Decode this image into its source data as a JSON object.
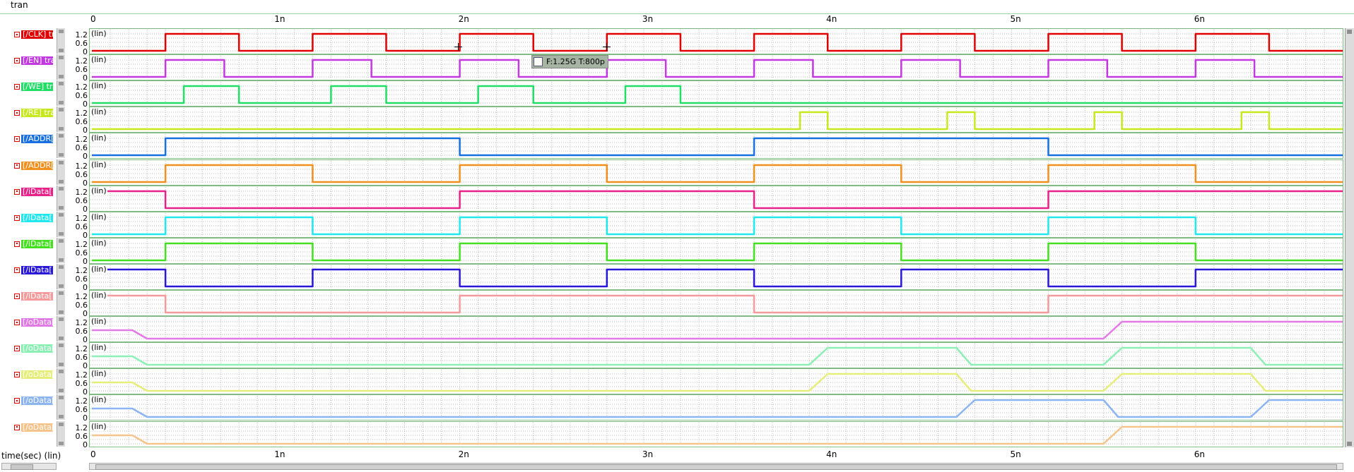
{
  "window": {
    "title": "tran"
  },
  "x_axis": {
    "label": "time(sec) (lin)",
    "tick_labels": [
      "0",
      "1n",
      "2n",
      "3n",
      "4n",
      "5n",
      "6n"
    ]
  },
  "y_axis": {
    "scale_label": "(lin)",
    "tick_labels": [
      "1.2",
      "0.6",
      "0"
    ]
  },
  "cursor": {
    "readout": "F:1.25G T:800p"
  },
  "chart_data": {
    "type": "line",
    "title": "tran",
    "xlabel": "time(sec) (lin)",
    "ylabel": "",
    "x_unit": "s",
    "xlim": [
      0,
      6.8e-09
    ],
    "ylim": [
      0,
      1.2
    ],
    "grid": true,
    "series": [
      {
        "name": "[/CLK] tr",
        "color": "#e00000",
        "levels": [
          [
            0,
            0
          ],
          [
            4e-10,
            1.2
          ],
          [
            8e-10,
            0
          ],
          [
            1.2e-09,
            1.2
          ],
          [
            1.6e-09,
            0
          ],
          [
            2e-09,
            1.2
          ],
          [
            2.4e-09,
            0
          ],
          [
            2.8e-09,
            1.2
          ],
          [
            3.2e-09,
            0
          ],
          [
            3.6e-09,
            1.2
          ],
          [
            4e-09,
            0
          ],
          [
            4.4e-09,
            1.2
          ],
          [
            4.8e-09,
            0
          ],
          [
            5.2e-09,
            1.2
          ],
          [
            5.6e-09,
            0
          ],
          [
            6e-09,
            1.2
          ],
          [
            6.4e-09,
            0
          ],
          [
            6.8e-09,
            0
          ]
        ]
      },
      {
        "name": "[/EN] tra",
        "color": "#c23adf",
        "levels": [
          [
            0,
            0
          ],
          [
            4e-10,
            1.2
          ],
          [
            7.2e-10,
            0
          ],
          [
            1.2e-09,
            1.2
          ],
          [
            1.52e-09,
            0
          ],
          [
            2e-09,
            1.2
          ],
          [
            2.32e-09,
            0
          ],
          [
            2.8e-09,
            1.2
          ],
          [
            3.12e-09,
            0
          ],
          [
            3.6e-09,
            1.2
          ],
          [
            3.92e-09,
            0
          ],
          [
            4.4e-09,
            1.2
          ],
          [
            4.72e-09,
            0
          ],
          [
            5.2e-09,
            1.2
          ],
          [
            5.52e-09,
            0
          ],
          [
            6e-09,
            1.2
          ],
          [
            6.32e-09,
            0
          ],
          [
            6.8e-09,
            0
          ]
        ]
      },
      {
        "name": "[/WE] tra",
        "color": "#22dd66",
        "levels": [
          [
            0,
            0
          ],
          [
            5e-10,
            1.2
          ],
          [
            8e-10,
            0
          ],
          [
            1.3e-09,
            1.2
          ],
          [
            1.6e-09,
            0
          ],
          [
            2.1e-09,
            1.2
          ],
          [
            2.4e-09,
            0
          ],
          [
            2.9e-09,
            1.2
          ],
          [
            3.2e-09,
            0
          ],
          [
            6.8e-09,
            0
          ]
        ]
      },
      {
        "name": "[/RE] tra",
        "color": "#c8e81e",
        "levels": [
          [
            0,
            0
          ],
          [
            3.85e-09,
            1.2
          ],
          [
            4e-09,
            0
          ],
          [
            4.65e-09,
            1.2
          ],
          [
            4.8e-09,
            0
          ],
          [
            5.45e-09,
            1.2
          ],
          [
            5.6e-09,
            0
          ],
          [
            6.25e-09,
            1.2
          ],
          [
            6.4e-09,
            0
          ],
          [
            6.8e-09,
            0
          ]
        ]
      },
      {
        "name": "[/ADDR[",
        "color": "#1870e0",
        "levels": [
          [
            0,
            0
          ],
          [
            4e-10,
            1.2
          ],
          [
            2e-09,
            0
          ],
          [
            3.6e-09,
            1.2
          ],
          [
            5.2e-09,
            0
          ],
          [
            6.8e-09,
            0
          ]
        ]
      },
      {
        "name": "[/ADDR[",
        "color": "#f0901e",
        "levels": [
          [
            0,
            0
          ],
          [
            4e-10,
            1.2
          ],
          [
            1.2e-09,
            0
          ],
          [
            2e-09,
            1.2
          ],
          [
            2.8e-09,
            0
          ],
          [
            3.6e-09,
            1.2
          ],
          [
            4.4e-09,
            0
          ],
          [
            5.2e-09,
            1.2
          ],
          [
            6e-09,
            0
          ],
          [
            6.8e-09,
            0
          ]
        ]
      },
      {
        "name": "[/iData[",
        "color": "#e8208a",
        "levels": [
          [
            0,
            1.2
          ],
          [
            4e-10,
            0
          ],
          [
            2e-09,
            1.2
          ],
          [
            3.6e-09,
            0
          ],
          [
            5.2e-09,
            1.2
          ],
          [
            6.8e-09,
            1.2
          ]
        ]
      },
      {
        "name": "[/iData[",
        "color": "#20e8ee",
        "levels": [
          [
            0,
            0
          ],
          [
            4e-10,
            1.2
          ],
          [
            1.2e-09,
            0
          ],
          [
            2e-09,
            1.2
          ],
          [
            2.8e-09,
            0
          ],
          [
            3.6e-09,
            1.2
          ],
          [
            4.4e-09,
            0
          ],
          [
            5.2e-09,
            1.2
          ],
          [
            6e-09,
            0
          ],
          [
            6.8e-09,
            0
          ]
        ]
      },
      {
        "name": "[/iData[",
        "color": "#44e020",
        "levels": [
          [
            0,
            0
          ],
          [
            4e-10,
            1.2
          ],
          [
            1.2e-09,
            0
          ],
          [
            2e-09,
            1.2
          ],
          [
            2.8e-09,
            0
          ],
          [
            3.6e-09,
            1.2
          ],
          [
            4.4e-09,
            0
          ],
          [
            5.2e-09,
            1.2
          ],
          [
            6e-09,
            0
          ],
          [
            6.8e-09,
            0
          ]
        ]
      },
      {
        "name": "[/iData[",
        "color": "#2a18d8",
        "levels": [
          [
            0,
            1.2
          ],
          [
            4e-10,
            0
          ],
          [
            1.2e-09,
            1.2
          ],
          [
            2e-09,
            0
          ],
          [
            2.8e-09,
            1.2
          ],
          [
            3.6e-09,
            0
          ],
          [
            4.4e-09,
            1.2
          ],
          [
            5.2e-09,
            0
          ],
          [
            6e-09,
            1.2
          ],
          [
            6.8e-09,
            1.2
          ]
        ]
      },
      {
        "name": "[/iData[",
        "color": "#f49a9a",
        "levels": [
          [
            0,
            1.2
          ],
          [
            4e-10,
            0
          ],
          [
            2e-09,
            1.2
          ],
          [
            3.6e-09,
            0
          ],
          [
            5.2e-09,
            1.2
          ],
          [
            6.8e-09,
            1.2
          ]
        ]
      },
      {
        "name": "[/oData[",
        "color": "#e27ae6",
        "smooth": true,
        "levels": [
          [
            0,
            0.6
          ],
          [
            2.2e-10,
            0.6
          ],
          [
            3e-10,
            0
          ],
          [
            5.5e-09,
            0
          ],
          [
            5.6e-09,
            1.2
          ],
          [
            6.8e-09,
            1.2
          ]
        ]
      },
      {
        "name": "[/oData[",
        "color": "#8cf0b4",
        "smooth": true,
        "levels": [
          [
            0,
            0.6
          ],
          [
            2.2e-10,
            0.6
          ],
          [
            3e-10,
            0
          ],
          [
            3.9e-09,
            0
          ],
          [
            4e-09,
            1.2
          ],
          [
            4.7e-09,
            1.2
          ],
          [
            4.78e-09,
            0
          ],
          [
            5.5e-09,
            0
          ],
          [
            5.6e-09,
            1.2
          ],
          [
            6.3e-09,
            1.2
          ],
          [
            6.38e-09,
            0
          ],
          [
            6.8e-09,
            0
          ]
        ]
      },
      {
        "name": "[/oData[",
        "color": "#e6ee7a",
        "smooth": true,
        "levels": [
          [
            0,
            0.6
          ],
          [
            2.2e-10,
            0.6
          ],
          [
            3e-10,
            0
          ],
          [
            3.9e-09,
            0
          ],
          [
            4e-09,
            1.2
          ],
          [
            4.7e-09,
            1.2
          ],
          [
            4.78e-09,
            0
          ],
          [
            5.5e-09,
            0
          ],
          [
            5.6e-09,
            1.2
          ],
          [
            6.3e-09,
            1.2
          ],
          [
            6.38e-09,
            0
          ],
          [
            6.8e-09,
            0
          ]
        ]
      },
      {
        "name": "[/oData[",
        "color": "#8cb4f0",
        "smooth": true,
        "levels": [
          [
            0,
            0.6
          ],
          [
            2.2e-10,
            0.6
          ],
          [
            3e-10,
            0
          ],
          [
            4.7e-09,
            0
          ],
          [
            4.8e-09,
            1.2
          ],
          [
            5.5e-09,
            1.2
          ],
          [
            5.58e-09,
            0
          ],
          [
            6.3e-09,
            0
          ],
          [
            6.4e-09,
            1.2
          ],
          [
            6.8e-09,
            1.2
          ]
        ]
      },
      {
        "name": "[/oData[",
        "color": "#f4c48c",
        "smooth": true,
        "levels": [
          [
            0,
            0.6
          ],
          [
            2.2e-10,
            0.6
          ],
          [
            3e-10,
            0
          ],
          [
            5.5e-09,
            0
          ],
          [
            5.6e-09,
            1.2
          ],
          [
            6.8e-09,
            1.2
          ]
        ]
      }
    ]
  }
}
